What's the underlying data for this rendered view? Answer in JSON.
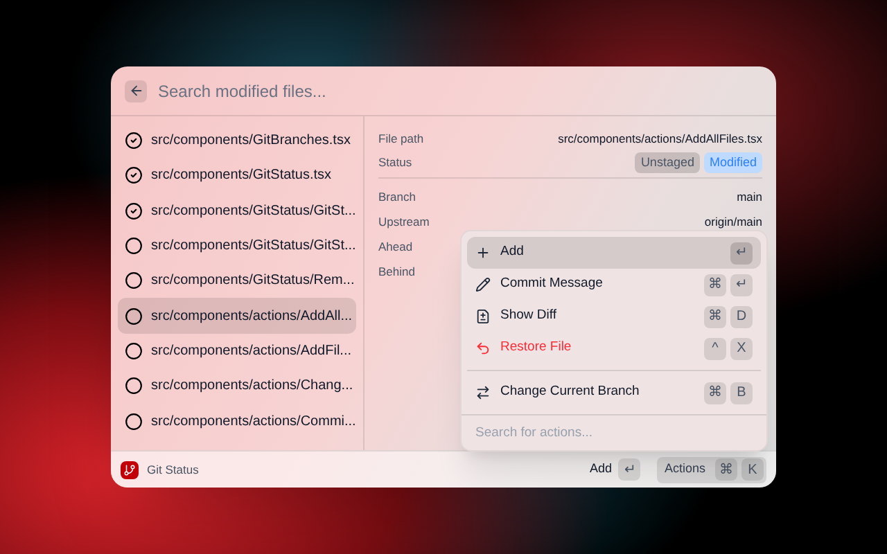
{
  "search": {
    "placeholder": "Search modified files..."
  },
  "files": [
    {
      "path": "src/components/GitBranches.tsx",
      "checked": true,
      "selected": false
    },
    {
      "path": "src/components/GitStatus.tsx",
      "checked": true,
      "selected": false
    },
    {
      "path": "src/components/GitStatus/GitSt...",
      "checked": true,
      "selected": false
    },
    {
      "path": "src/components/GitStatus/GitSt...",
      "checked": false,
      "selected": false
    },
    {
      "path": "src/components/GitStatus/Rem...",
      "checked": false,
      "selected": false
    },
    {
      "path": "src/components/actions/AddAll...",
      "checked": false,
      "selected": true
    },
    {
      "path": "src/components/actions/AddFil...",
      "checked": false,
      "selected": false
    },
    {
      "path": "src/components/actions/Chang...",
      "checked": false,
      "selected": false
    },
    {
      "path": "src/components/actions/Commi...",
      "checked": false,
      "selected": false
    }
  ],
  "details": {
    "file_path": {
      "label": "File path",
      "value": "src/components/actions/AddAllFiles.tsx"
    },
    "status": {
      "label": "Status",
      "tags": [
        {
          "text": "Unstaged",
          "kind": "grey"
        },
        {
          "text": "Modified",
          "kind": "blue"
        }
      ]
    },
    "rows": [
      {
        "label": "Branch",
        "value": "main"
      },
      {
        "label": "Upstream",
        "value": "origin/main"
      },
      {
        "label": "Ahead"
      },
      {
        "label": "Behind"
      }
    ]
  },
  "actions_menu": {
    "items": [
      {
        "kind": "plus",
        "label": "Add",
        "selected": true,
        "danger": false,
        "keys": [
          "↵"
        ]
      },
      {
        "kind": "pencil",
        "label": "Commit Message",
        "selected": false,
        "danger": false,
        "keys": [
          "⌘",
          "↵"
        ]
      },
      {
        "kind": "diff",
        "label": "Show Diff",
        "selected": false,
        "danger": false,
        "keys": [
          "⌘",
          "D"
        ]
      },
      {
        "kind": "restore",
        "label": "Restore File",
        "selected": false,
        "danger": true,
        "keys": [
          "^",
          "X"
        ]
      },
      {
        "kind": "branch",
        "label": "Change Current Branch",
        "selected": false,
        "danger": false,
        "keys": [
          "⌘",
          "B"
        ]
      }
    ],
    "placeholder": "Search for actions..."
  },
  "footer": {
    "title": "Git Status",
    "primary": {
      "label": "Add",
      "keys": [
        "↵"
      ]
    },
    "actions": {
      "label": "Actions",
      "keys": [
        "⌘",
        "K"
      ]
    }
  }
}
